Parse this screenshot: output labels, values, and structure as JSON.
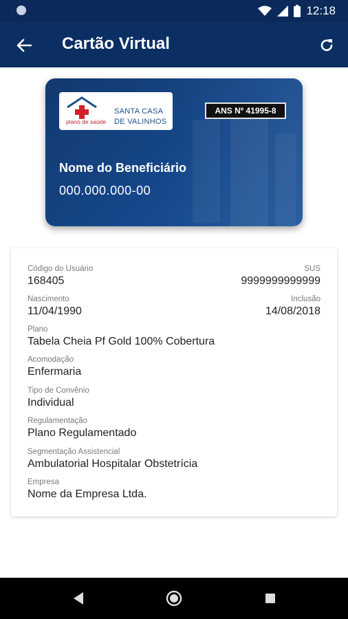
{
  "status_bar": {
    "time": "12:18",
    "icons": [
      "wifi-icon",
      "signal-icon",
      "battery-icon"
    ]
  },
  "app_bar": {
    "title": "Cartão Virtual",
    "back_icon": "arrow-left-icon",
    "refresh_icon": "refresh-icon"
  },
  "card": {
    "logo_tagline": "plano de saúde",
    "logo_line1": "SANTA CASA",
    "logo_line2": "DE VALINHOS",
    "ans": "ANS Nº 41995-8",
    "name": "Nome do Beneficiário",
    "number": "000.000.000-00",
    "colors": {
      "primary": "#12396f",
      "accent": "#d0202a"
    }
  },
  "details": {
    "codigo_label": "Código do Usuário",
    "codigo_value": "168405",
    "sus_label": "SUS",
    "sus_value": "9999999999999",
    "nascimento_label": "Nascimento",
    "nascimento_value": "11/04/1990",
    "inclusao_label": "Inclusão",
    "inclusao_value": "14/08/2018",
    "plano_label": "Plano",
    "plano_value": "Tabela Cheia Pf Gold 100% Cobertura",
    "acomodacao_label": "Acomodação",
    "acomodacao_value": "Enfermaria",
    "tipo_label": "Tipo de Convênio",
    "tipo_value": "Individual",
    "regulamentacao_label": "Regulamentação",
    "regulamentacao_value": "Plano Regulamentado",
    "segmentacao_label": "Segmentação Assistencial",
    "segmentacao_value": "Ambulatorial Hospitalar Obstetrícia",
    "empresa_label": "Empresa",
    "empresa_value": "Nome da Empresa Ltda."
  },
  "colors": {
    "statusbar": "#0b2a5a",
    "appbar": "#0b2f63"
  }
}
